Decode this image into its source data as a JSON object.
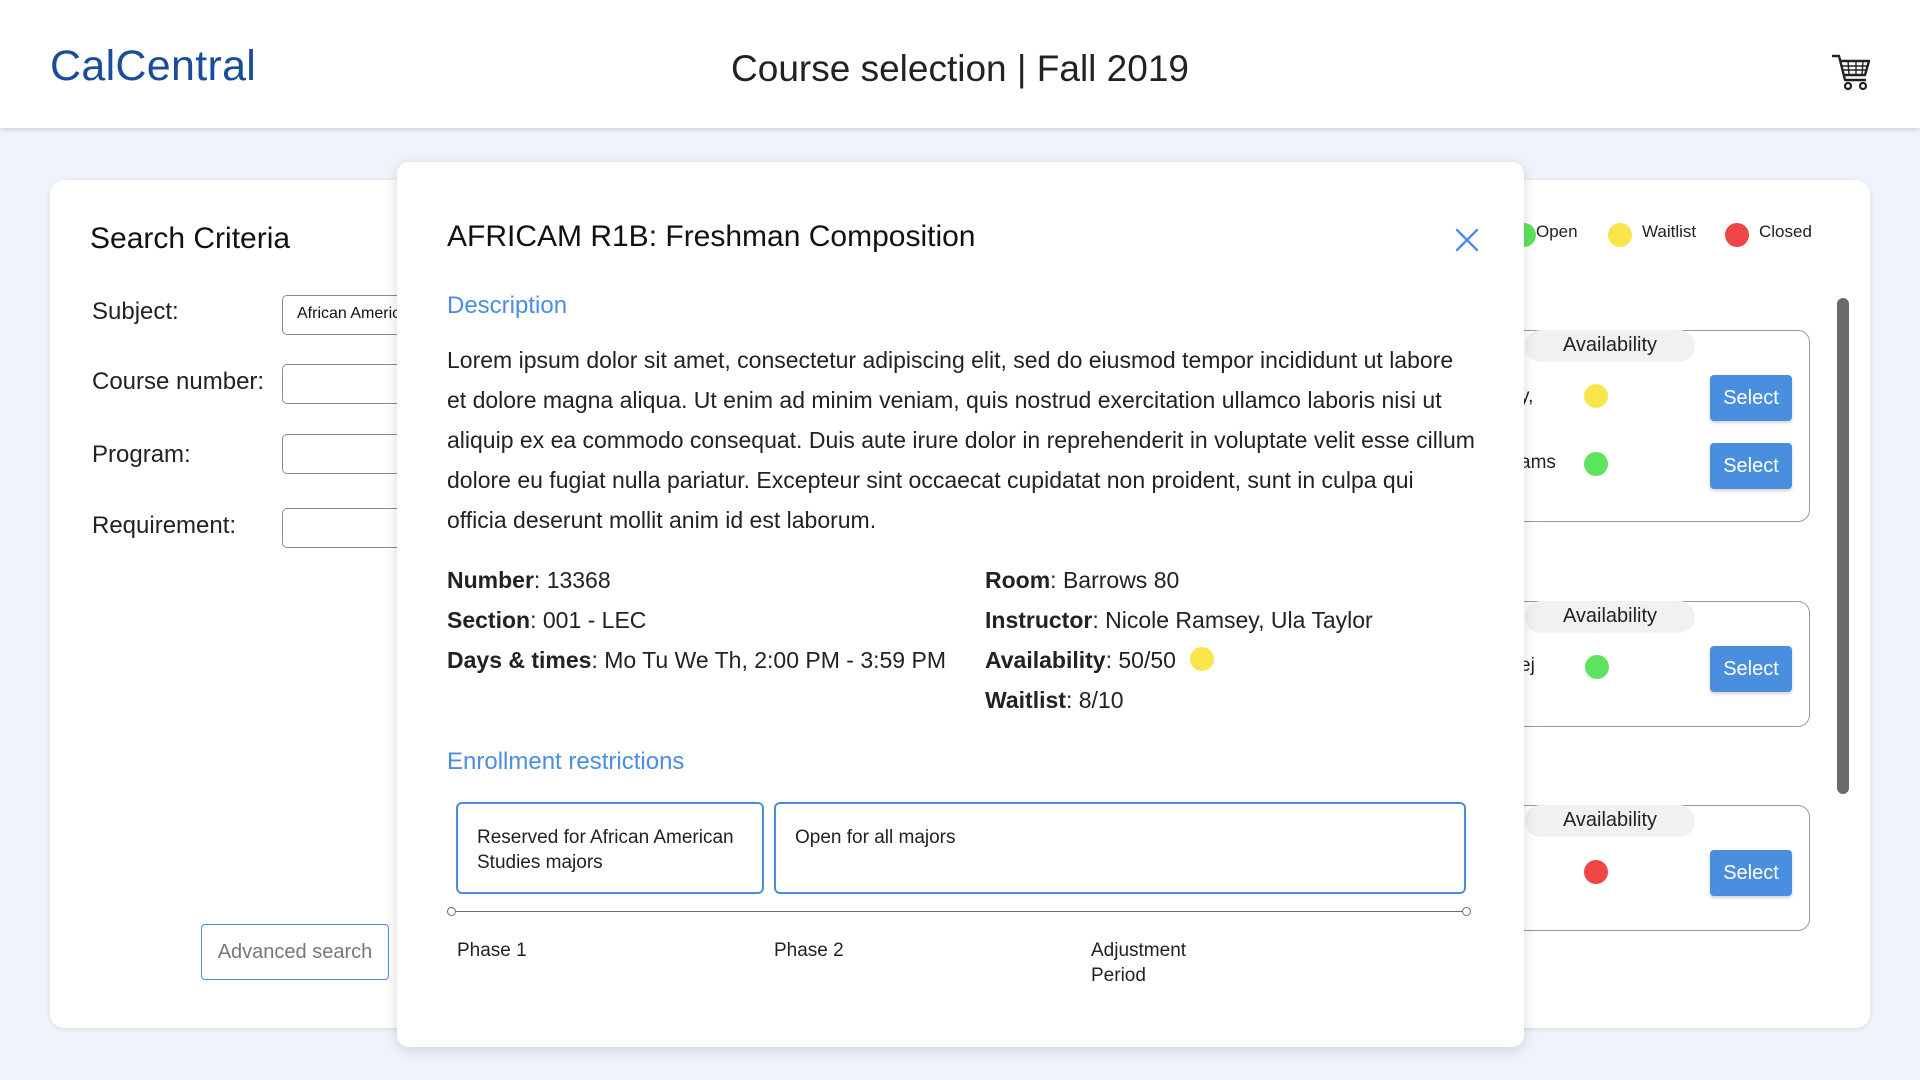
{
  "header": {
    "logo": "CalCentral",
    "title": "Course selection | Fall 2019",
    "cart_icon": "shopping-cart-icon"
  },
  "search": {
    "title": "Search Criteria",
    "fields": [
      {
        "label": "Subject:",
        "value": "African American Studies"
      },
      {
        "label": "Course number:",
        "value": ""
      },
      {
        "label": "Program:",
        "value": ""
      },
      {
        "label": "Requirement:",
        "value": ""
      }
    ],
    "advanced_button": "Advanced search"
  },
  "legend": {
    "open": "Open",
    "waitlist": "Waitlist",
    "closed": "Closed",
    "colors": {
      "open": "#5de35d",
      "waitlist": "#fae54a",
      "closed": "#ee4545"
    }
  },
  "results": [
    {
      "availability_label": "Availability",
      "rows": [
        {
          "text": "y,",
          "status": "waitlist",
          "button": "Select"
        },
        {
          "text": "ams",
          "status": "open",
          "button": "Select"
        }
      ]
    },
    {
      "availability_label": "Availability",
      "rows": [
        {
          "text": "ej",
          "status": "open",
          "button": "Select"
        }
      ]
    },
    {
      "availability_label": "Availability",
      "rows": [
        {
          "text": "",
          "status": "closed",
          "button": "Select"
        }
      ]
    }
  ],
  "modal": {
    "title": "AFRICAM R1B: Freshman Composition",
    "description_heading": "Description",
    "description": "Lorem ipsum dolor sit amet, consectetur adipiscing elit, sed do eiusmod tempor incididunt ut labore et dolore magna aliqua. Ut enim ad minim veniam, quis nostrud exercitation ullamco laboris nisi ut aliquip ex ea commodo consequat. Duis aute irure dolor in reprehenderit in voluptate velit esse cillum dolore eu fugiat nulla pariatur. Excepteur sint occaecat cupidatat non proident, sunt in culpa qui officia deserunt mollit anim id est laborum.",
    "details": {
      "number_label": "Number",
      "number": "13368",
      "section_label": "Section",
      "section": "001 - LEC",
      "days_label": "Days & times",
      "days": "Mo Tu We Th, 2:00 PM - 3:59 PM",
      "room_label": "Room",
      "room": "Barrows 80",
      "instructor_label": "Instructor",
      "instructor": "Nicole Ramsey, Ula Taylor",
      "availability_label": "Availability",
      "availability": "50/50",
      "waitlist_label": "Waitlist",
      "waitlist": "8/10"
    },
    "restrictions_heading": "Enrollment restrictions",
    "phases": [
      {
        "box": "Reserved for African American Studies majors",
        "label": "Phase 1"
      },
      {
        "box": "Open for all majors",
        "label": "Phase 2"
      },
      {
        "box": "",
        "label": "Adjustment Period"
      }
    ]
  }
}
